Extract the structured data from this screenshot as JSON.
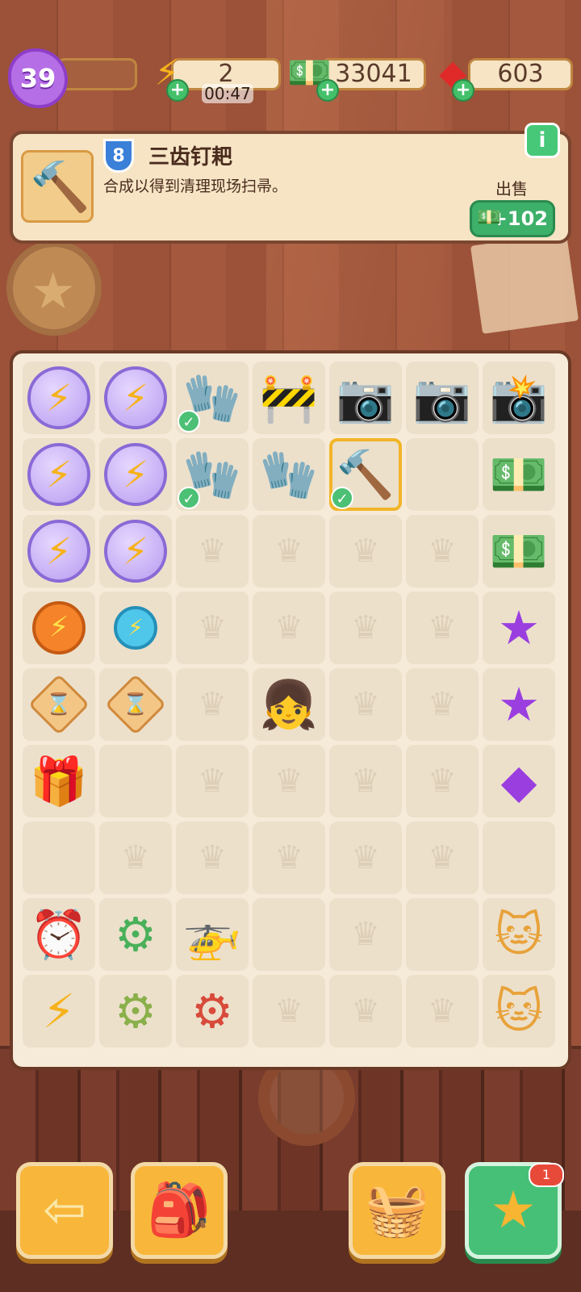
{
  "topbar": {
    "level": "39",
    "energy": {
      "value": "2",
      "timer": "00:47"
    },
    "cash": {
      "value": "33041"
    },
    "gems": {
      "value": "603"
    }
  },
  "info": {
    "item_level": "8",
    "title": "三齿钉耙",
    "description": "合成以得到清理现场扫帚。",
    "info_button": "i",
    "sell_label": "出售",
    "sell_value": "+102"
  },
  "board": {
    "rows": [
      [
        "energy-orb",
        "energy-orb",
        "red-gloves",
        "road-barrier",
        "camera",
        "camera",
        "pro-camera"
      ],
      [
        "energy-orb",
        "energy-orb",
        "red-gloves",
        "white-glove",
        "rake",
        "empty",
        "cash-pile"
      ],
      [
        "energy-orb",
        "energy-orb",
        "locked",
        "locked",
        "locked",
        "locked",
        "cash-stack"
      ],
      [
        "energy-orange",
        "energy-blue",
        "locked",
        "locked",
        "locked",
        "locked",
        "purple-star"
      ],
      [
        "hourglass",
        "hourglass",
        "locked",
        "character",
        "locked",
        "locked",
        "purple-star-smile"
      ],
      [
        "gift-box",
        "empty",
        "locked",
        "locked",
        "locked",
        "locked",
        "purple-gem"
      ],
      [
        "empty",
        "locked",
        "locked",
        "locked",
        "locked",
        "locked",
        "empty"
      ],
      [
        "workbench-clock",
        "green-machine",
        "helicopter",
        "empty",
        "locked",
        "empty",
        "lucky-cat"
      ],
      [
        "workbench-energy",
        "green-machine-2",
        "red-machine",
        "locked",
        "locked",
        "locked",
        "lucky-cat-2"
      ]
    ]
  },
  "bottom": {
    "star_badge": "1"
  }
}
